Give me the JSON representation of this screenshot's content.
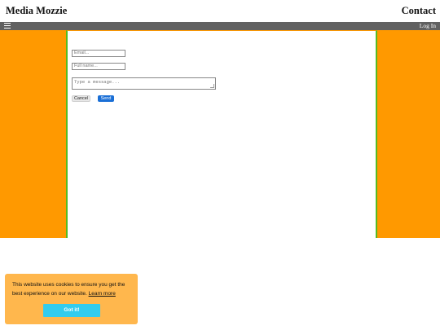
{
  "header": {
    "brand": "Media Mozzie",
    "contact": "Contact"
  },
  "navbar": {
    "menu_icon": "hamburger-menu-icon",
    "login": "Log In"
  },
  "form": {
    "email_placeholder": "Email...",
    "fullname_placeholder": "Full name...",
    "message_placeholder": "Type a message...",
    "cancel_label": "Cancel",
    "send_label": "Send"
  },
  "cookie": {
    "text": "This website uses cookies to ensure you get the best experience on our website.",
    "learn_more": "Learn more",
    "button": "Got it!"
  },
  "colors": {
    "side": "#ff9900",
    "border": "#55bb22",
    "navbar": "#616161",
    "send": "#1a6fd6",
    "cookie_bg": "#ffb74d",
    "cookie_button": "#33ccee"
  }
}
